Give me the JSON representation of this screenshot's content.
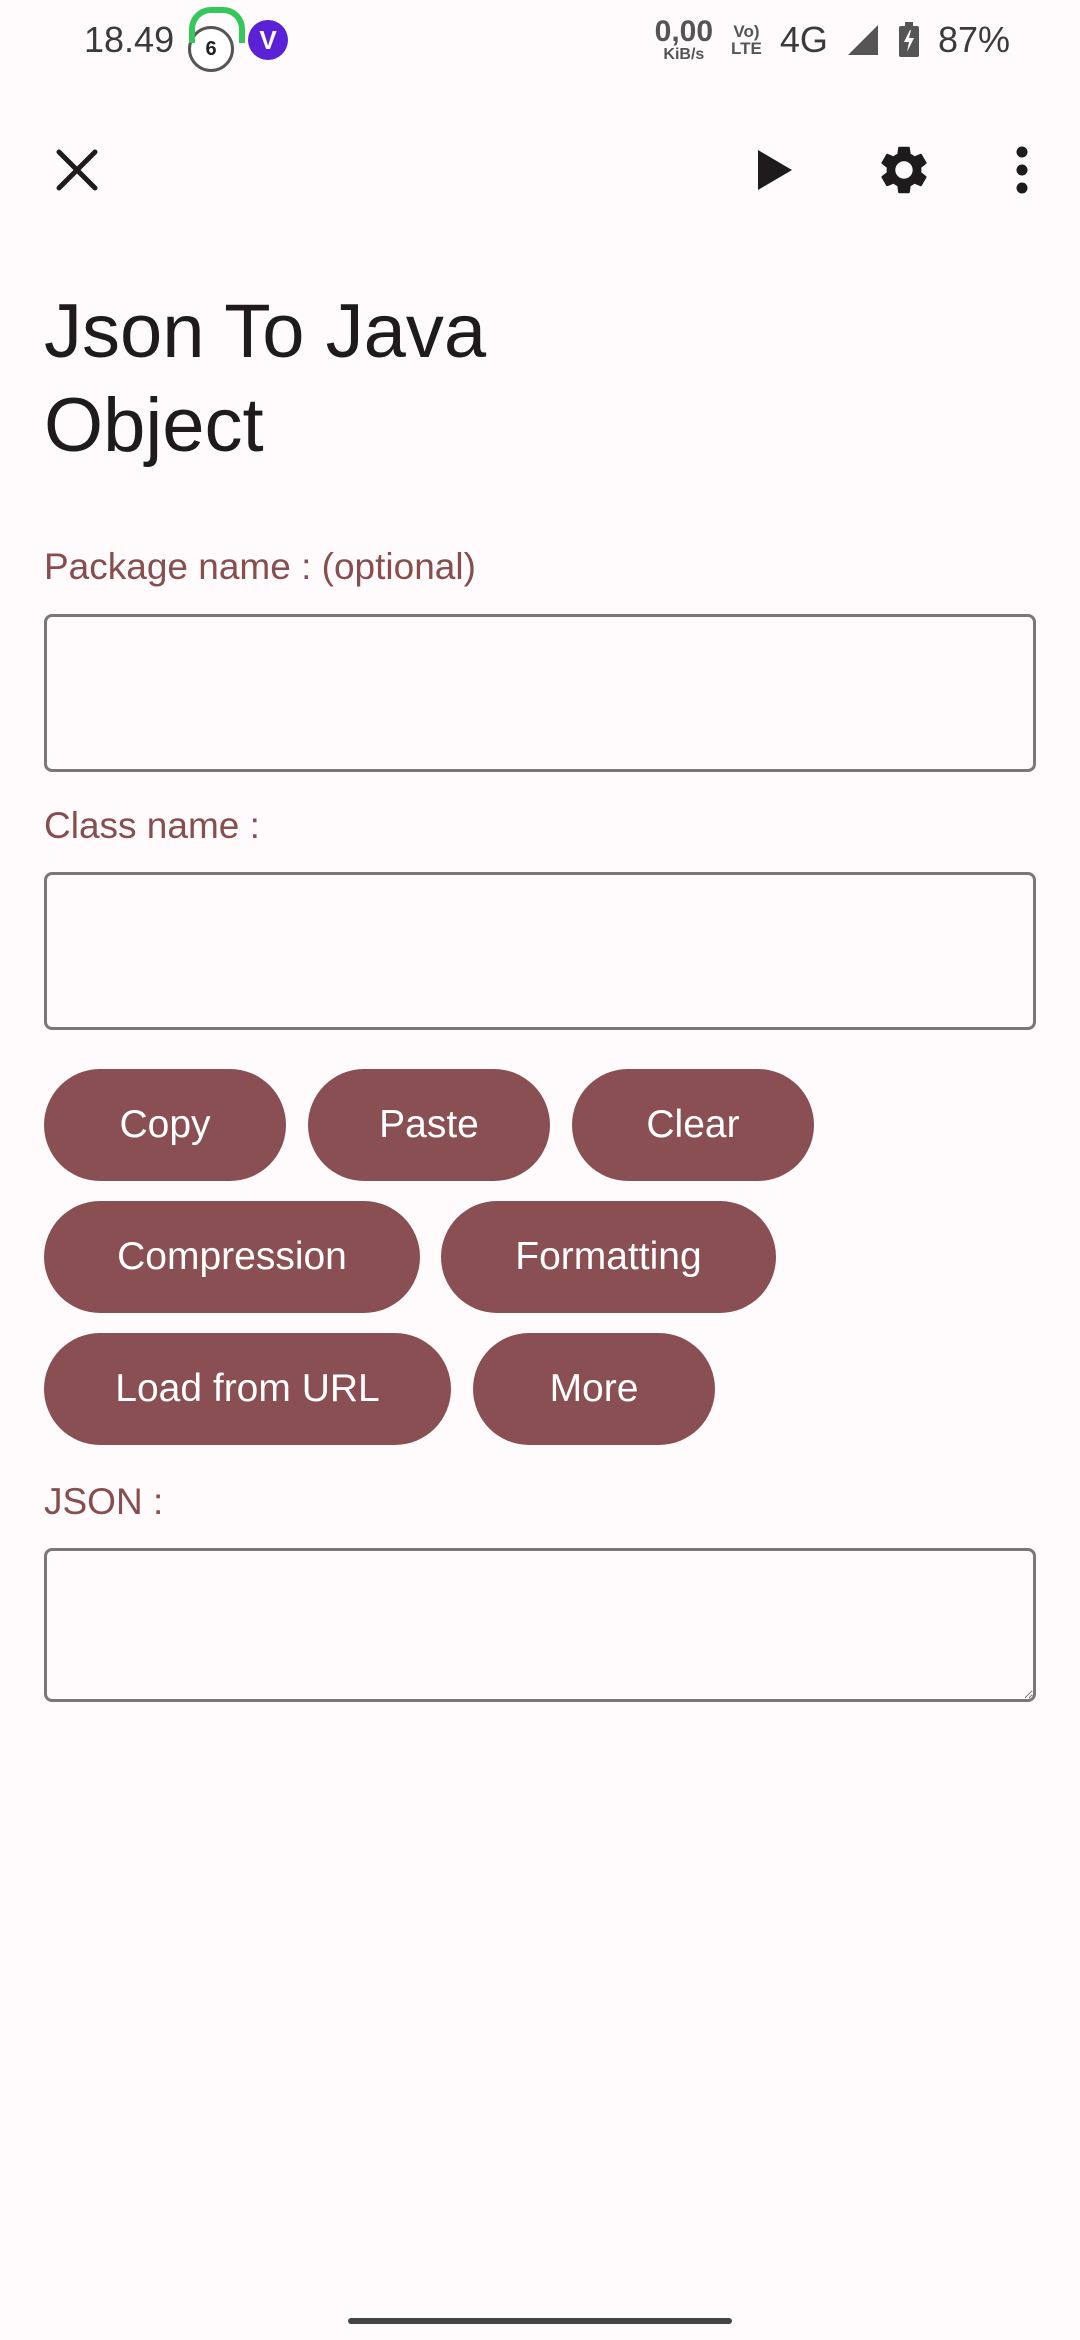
{
  "status_bar": {
    "time": "18.49",
    "notification_count": "6",
    "vpn_letter": "V",
    "net_speed_value": "0,00",
    "net_speed_unit": "KiB/s",
    "volte_top": "Vo)",
    "volte_bottom": "LTE",
    "network_type": "4G",
    "battery_percent": "87%"
  },
  "app_bar": {
    "close_icon": "close-icon",
    "run_icon": "play-icon",
    "settings_icon": "gear-icon",
    "more_icon": "more-vert-icon"
  },
  "page": {
    "title_line1": "Json To Java",
    "title_line2": "Object"
  },
  "form": {
    "package_label": "Package name : (optional)",
    "package_value": "",
    "class_label": "Class name :",
    "class_value": "",
    "json_label": "JSON :",
    "json_value": ""
  },
  "actions": {
    "copy": "Copy",
    "paste": "Paste",
    "clear": "Clear",
    "compression": "Compression",
    "formatting": "Formatting",
    "load_from_url": "Load from URL",
    "more": "More"
  },
  "colors": {
    "accent": "#8a4f52",
    "label": "#874e50",
    "background": "#fffbfc",
    "outline": "#7d7576"
  }
}
